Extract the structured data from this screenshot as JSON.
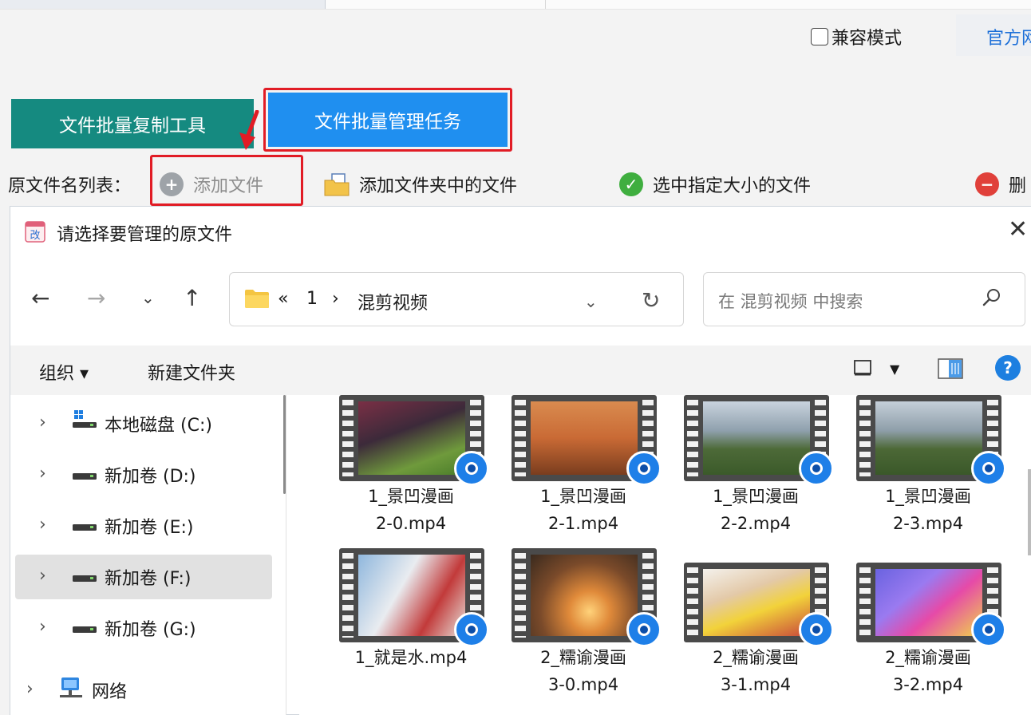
{
  "app": {
    "compat_mode_label": "兼容模式",
    "official_label": "官方网",
    "tabs": [
      {
        "label": "文件批量复制工具"
      },
      {
        "label": "文件批量管理任务"
      }
    ],
    "file_list": {
      "label": "原文件名列表：",
      "actions": [
        {
          "label": "添加文件"
        },
        {
          "label": "添加文件夹中的文件"
        },
        {
          "label": "选中指定大小的文件"
        },
        {
          "label": "删"
        }
      ]
    }
  },
  "colors": {
    "copy_tool_bg": "#158a80",
    "manage_task_bg": "#1f8ff0",
    "highlight": "#e11c25"
  },
  "dialog": {
    "title": "请选择要管理的原文件",
    "close_glyph": "✕",
    "breadcrumb": {
      "overflow": "«",
      "parent": "1",
      "separator": "›",
      "current": "混剪视频"
    },
    "search_placeholder": "在 混剪视频 中搜索",
    "commands": {
      "organize": "组织 ▾",
      "new_folder": "新建文件夹"
    },
    "help_glyph": "?",
    "nav_tree": [
      {
        "label": "本地磁盘 (C:)",
        "icon": "windows-drive-icon"
      },
      {
        "label": "新加卷 (D:)",
        "icon": "drive-icon"
      },
      {
        "label": "新加卷 (E:)",
        "icon": "drive-icon"
      },
      {
        "label": "新加卷 (F:)",
        "icon": "drive-icon",
        "selected": true
      },
      {
        "label": "新加卷 (G:)",
        "icon": "drive-icon"
      },
      {
        "label": "网络",
        "icon": "network-icon"
      }
    ],
    "files": [
      {
        "line1": "1_景凹漫画",
        "line2": "2-0.mp4"
      },
      {
        "line1": "1_景凹漫画",
        "line2": "2-1.mp4"
      },
      {
        "line1": "1_景凹漫画",
        "line2": "2-2.mp4"
      },
      {
        "line1": "1_景凹漫画",
        "line2": "2-3.mp4"
      },
      {
        "line1": "1_就是水.mp4",
        "line2": ""
      },
      {
        "line1": "2_糯谕漫画",
        "line2": "3-0.mp4"
      },
      {
        "line1": "2_糯谕漫画",
        "line2": "3-1.mp4"
      },
      {
        "line1": "2_糯谕漫画",
        "line2": "3-2.mp4"
      }
    ]
  }
}
